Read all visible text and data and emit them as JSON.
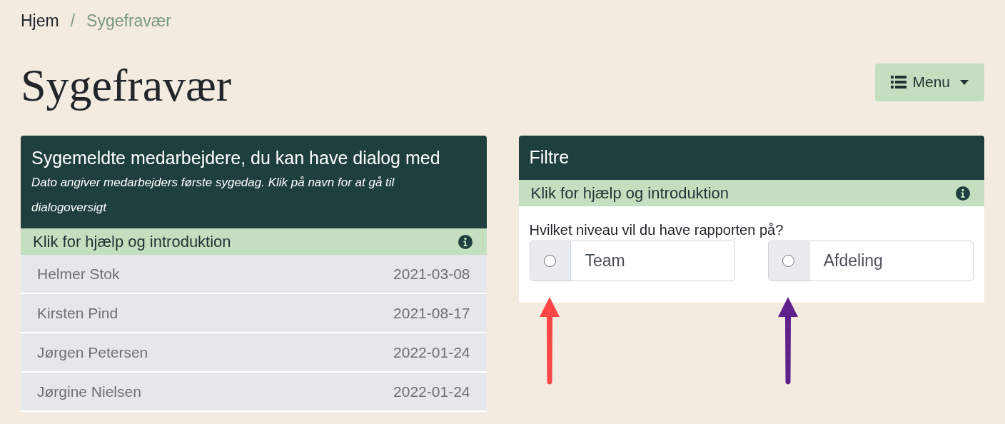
{
  "breadcrumb": [
    {
      "label": "Hjem",
      "current": false
    },
    {
      "label": "Sygefravær",
      "current": true
    }
  ],
  "separator": "/",
  "title": "Sygefravær",
  "menu_button": {
    "label": "Menu"
  },
  "employees_card": {
    "title": "Sygemeldte medarbejdere, du kan have dialog med",
    "subtitle": "Dato angiver medarbejders første sygedag. Klik på navn for at gå til dialogoversigt",
    "help": "Klik for hjælp og introduktion",
    "rows": [
      {
        "name": "Helmer Stok",
        "date": "2021-03-08"
      },
      {
        "name": "Kirsten Pind",
        "date": "2021-08-17"
      },
      {
        "name": "Jørgen Petersen",
        "date": "2022-01-24"
      },
      {
        "name": "Jørgine Nielsen",
        "date": "2022-01-24"
      }
    ]
  },
  "filters_card": {
    "title": "Filtre",
    "help": "Klik for hjælp og introduktion",
    "question": "Hvilket niveau vil du have rapporten på?",
    "options": [
      {
        "label": "Team",
        "selected": false
      },
      {
        "label": "Afdeling",
        "selected": false
      }
    ]
  },
  "arrows": [
    {
      "color": "#ff4545"
    },
    {
      "color": "#61218a"
    }
  ]
}
